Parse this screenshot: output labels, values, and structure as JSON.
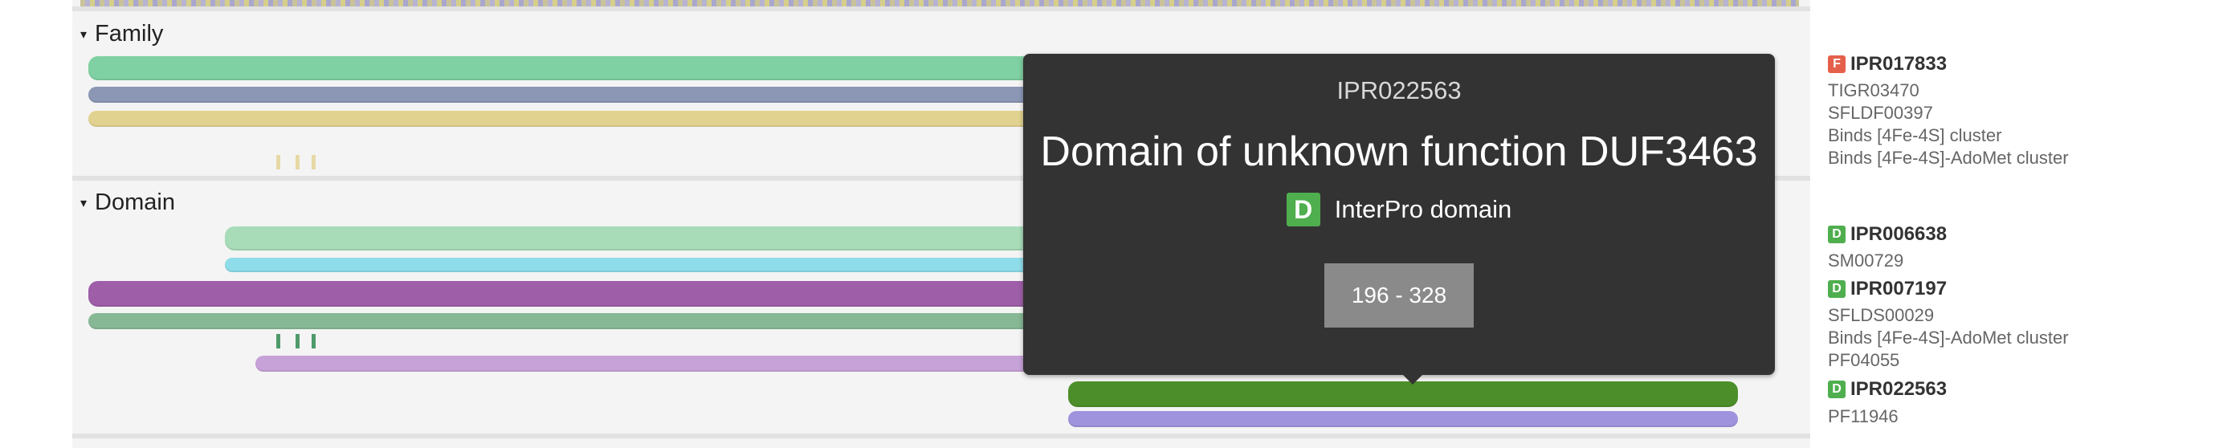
{
  "sections": {
    "family": {
      "title": "Family"
    },
    "domain": {
      "title": "Domain"
    }
  },
  "legend": {
    "family": [
      {
        "badge": "F",
        "accession": "IPR017833",
        "badge_color": "#e5604b",
        "members": [
          "TIGR03470",
          "SFLDF00397",
          "Binds [4Fe-4S] cluster",
          "Binds [4Fe-4S]-AdoMet cluster"
        ]
      }
    ],
    "domain": [
      {
        "badge": "D",
        "accession": "IPR006638",
        "badge_color": "#4fae4e",
        "members": [
          "SM00729"
        ]
      },
      {
        "badge": "D",
        "accession": "IPR007197",
        "badge_color": "#4fae4e",
        "members": [
          "SFLDS00029",
          "Binds [4Fe-4S]-AdoMet cluster",
          "PF04055"
        ]
      },
      {
        "badge": "D",
        "accession": "IPR022563",
        "badge_color": "#4fae4e",
        "members": [
          "PF11946"
        ]
      }
    ]
  },
  "tooltip": {
    "accession": "IPR022563",
    "name": "Domain of unknown function DUF3463",
    "type_badge": "D",
    "type_label": "InterPro domain",
    "range": "196 - 328"
  },
  "colors": {
    "family_green": "#7fd0a2",
    "family_slate": "#8b97b5",
    "family_khaki": "#e2d28f",
    "domain_mint": "#a8dbb8",
    "domain_cyan": "#8fdcea",
    "domain_purple": "#9e5ea8",
    "domain_sage": "#86b895",
    "domain_lilac": "#c7a2d8",
    "domain_darkgreen": "#4c8f2a",
    "domain_violet": "#9f93dd"
  }
}
